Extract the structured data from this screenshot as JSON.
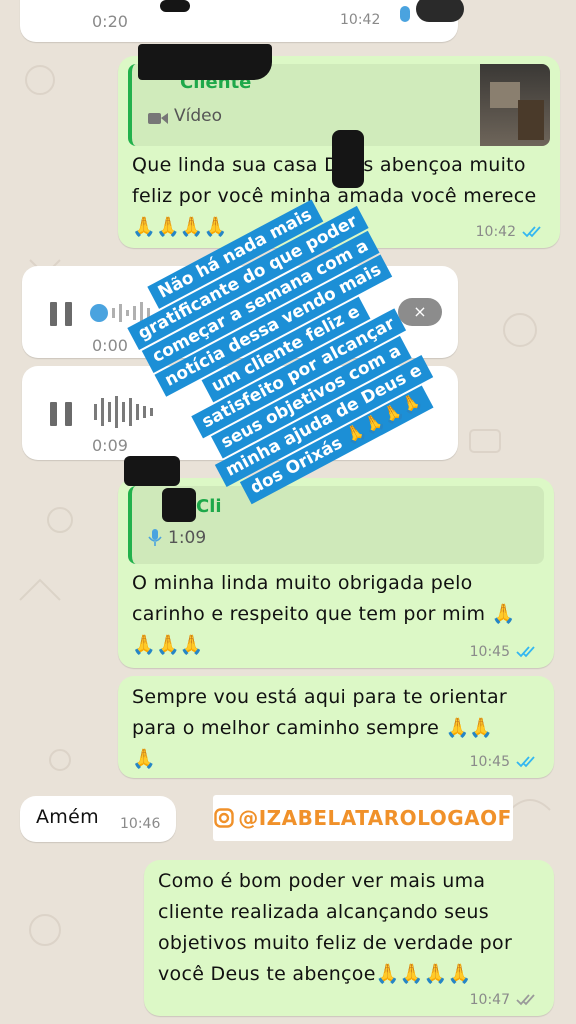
{
  "top_partial": {
    "voice_time": "0:20",
    "timestamp": "10:42"
  },
  "msg1": {
    "quote_name": "Cliente",
    "quote_type": "Vídeo",
    "text": "Que linda sua casa       Deus abençoa muito feliz por você minha amada você merece",
    "emoji": "🙏🙏🙏🙏",
    "time": "10:42"
  },
  "voice1": {
    "duration": "0:00"
  },
  "voice2": {
    "duration": "0:09"
  },
  "msg2": {
    "quote_name": "Cli",
    "quote_duration": "1:09",
    "text_line1": "O minha linda muito obrigada pelo",
    "text_line2": "carinho e respeito que tem por mim",
    "emoji": "🙏",
    "emoji2": "🙏🙏🙏",
    "time": "10:45"
  },
  "msg3": {
    "text_line1": "Sempre vou está aqui para te orientar",
    "text_line2": "para o melhor caminho sempre",
    "emoji": "🙏🙏",
    "emoji2": "🙏",
    "time": "10:45"
  },
  "msg4": {
    "text": "Amém",
    "time": "10:46"
  },
  "msg5": {
    "text_line1": "Como é bom poder ver mais uma",
    "text_line2": "cliente realizada alcançando seus",
    "text_line3": "objetivos muito feliz de verdade por",
    "text_line4": "você Deus te abençoe",
    "emoji": "🙏🙏🙏🙏",
    "time": "10:47"
  },
  "overlay": {
    "lines": [
      "Não há nada mais",
      "gratificante do que poder",
      "começar a semana com a",
      "notícia dessa vendo mais",
      "um cliente feliz e",
      "satisfeito por alcançar",
      "seus objetivos com a",
      "minha ajuda de Deus e",
      "dos Orixás 🙏🙏🙏🙏"
    ]
  },
  "instagram_handle": "@IZABELATAROLOGAOF",
  "colors": {
    "incoming_bubble": "#ffffff",
    "outgoing_bubble": "#dcf8c6",
    "read_ticks": "#34b7f1",
    "overlay_bg": "#1c8fd6",
    "handle_text": "#f0912a"
  }
}
